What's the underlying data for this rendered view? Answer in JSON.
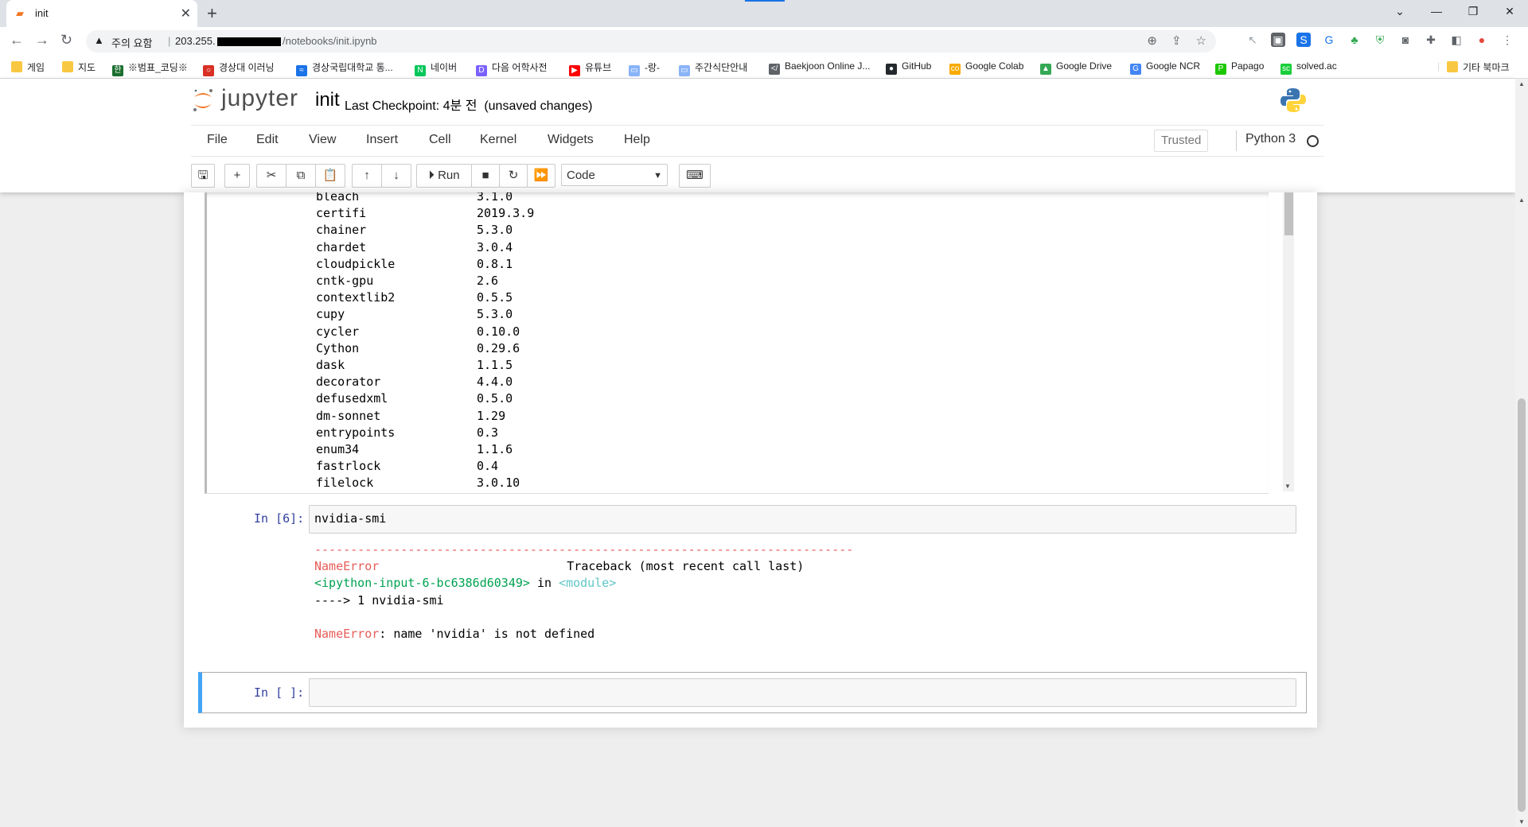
{
  "browser": {
    "tab_title": "init",
    "new_tab": "+",
    "url_warning": "주의 요함",
    "url_host": "203.255.",
    "url_path": "/notebooks/init.ipynb",
    "window_controls": [
      "⌄",
      "—",
      "❐",
      "✕"
    ]
  },
  "bookmarks": [
    {
      "label": "게임",
      "icon": "folder-icon",
      "color": "#f9c842"
    },
    {
      "label": "지도",
      "icon": "folder-icon",
      "color": "#f9c842"
    },
    {
      "label": "※범표_코딩※",
      "icon": "hwp-icon",
      "color": "#1b6e2f"
    },
    {
      "label": "경상대 이러닝",
      "icon": "circle-icon",
      "color": "#d93025"
    },
    {
      "label": "경상국립대학교 통...",
      "icon": "wave-icon",
      "color": "#1a73e8"
    },
    {
      "label": "네이버",
      "icon": "naver-icon",
      "color": "#03c75a"
    },
    {
      "label": "다음 어학사전",
      "icon": "daum-icon",
      "color": "#7b61ff"
    },
    {
      "label": "유튜브",
      "icon": "youtube-icon",
      "color": "#ff0000"
    },
    {
      "label": "-랑-",
      "icon": "page-icon",
      "color": "#8ab4f8"
    },
    {
      "label": "주간식단안내",
      "icon": "page-icon",
      "color": "#8ab4f8"
    },
    {
      "label": "Baekjoon Online J...",
      "icon": "code-icon",
      "color": "#5f6368"
    },
    {
      "label": "GitHub",
      "icon": "github-icon",
      "color": "#24292e"
    },
    {
      "label": "Google Colab",
      "icon": "colab-icon",
      "color": "#f9ab00"
    },
    {
      "label": "Google Drive",
      "icon": "drive-icon",
      "color": "#34a853"
    },
    {
      "label": "Google NCR",
      "icon": "google-icon",
      "color": "#4285f4"
    },
    {
      "label": "Papago",
      "icon": "papago-icon",
      "color": "#1ec800"
    },
    {
      "label": "solved.ac",
      "icon": "solved-icon",
      "color": "#17ce3a"
    },
    {
      "label": "기타 북마크",
      "icon": "folder-icon",
      "color": "#f9c842"
    }
  ],
  "jupyter": {
    "logo_text": "jupyter",
    "notebook_name": "init",
    "checkpoint": "Last Checkpoint: 4분 전",
    "unsaved": "(unsaved changes)",
    "menus": [
      "File",
      "Edit",
      "View",
      "Insert",
      "Cell",
      "Kernel",
      "Widgets",
      "Help"
    ],
    "trusted": "Trusted",
    "kernel_name": "Python 3",
    "run_label": "Run",
    "cell_type": "Code"
  },
  "package_list": [
    {
      "name": "bleach",
      "version": "3.1.0"
    },
    {
      "name": "certifi",
      "version": "2019.3.9"
    },
    {
      "name": "chainer",
      "version": "5.3.0"
    },
    {
      "name": "chardet",
      "version": "3.0.4"
    },
    {
      "name": "cloudpickle",
      "version": "0.8.1"
    },
    {
      "name": "cntk-gpu",
      "version": "2.6"
    },
    {
      "name": "contextlib2",
      "version": "0.5.5"
    },
    {
      "name": "cupy",
      "version": "5.3.0"
    },
    {
      "name": "cycler",
      "version": "0.10.0"
    },
    {
      "name": "Cython",
      "version": "0.29.6"
    },
    {
      "name": "dask",
      "version": "1.1.5"
    },
    {
      "name": "decorator",
      "version": "4.4.0"
    },
    {
      "name": "defusedxml",
      "version": "0.5.0"
    },
    {
      "name": "dm-sonnet",
      "version": "1.29"
    },
    {
      "name": "entrypoints",
      "version": "0.3"
    },
    {
      "name": "enum34",
      "version": "1.1.6"
    },
    {
      "name": "fastrlock",
      "version": "0.4"
    },
    {
      "name": "filelock",
      "version": "3.0.10"
    }
  ],
  "cell6": {
    "prompt": "In [6]:",
    "code": "nvidia-smi",
    "dashes": "---------------------------------------------------------------------------",
    "err_name": "NameError",
    "traceback_label": "Traceback (most recent call last)",
    "input_ref": "<ipython-input-6-bc6386d60349>",
    "in_word": " in ",
    "module": "<module>",
    "arrow_line": "----> 1 nvidia-smi",
    "err_msg": ": name 'nvidia' is not defined"
  },
  "cell_empty": {
    "prompt": "In [ ]:"
  }
}
